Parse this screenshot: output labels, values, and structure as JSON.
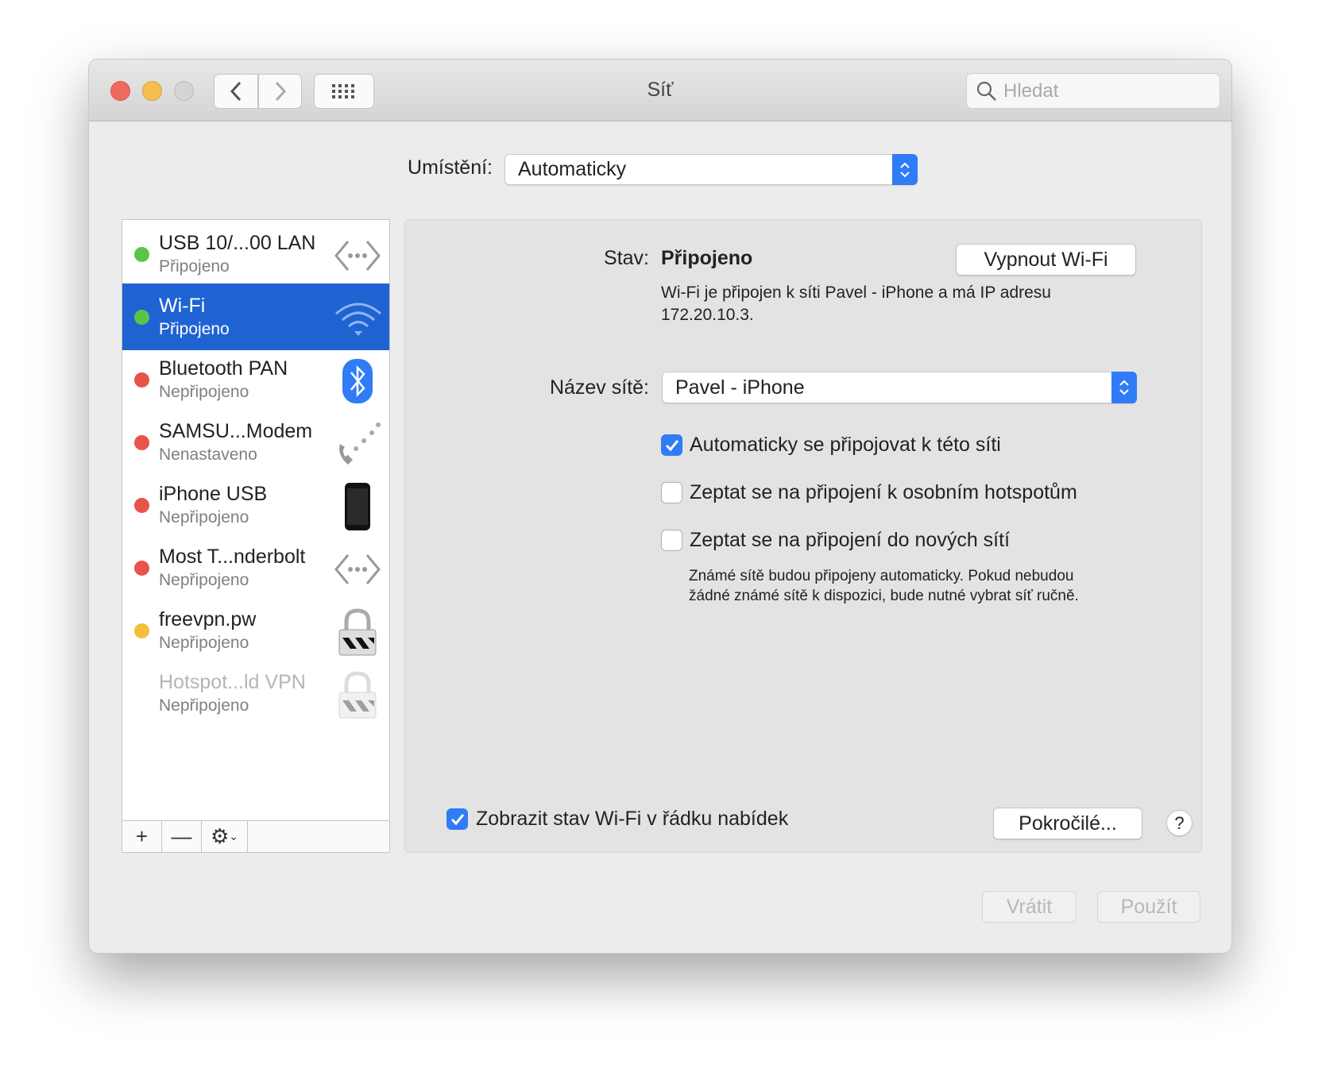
{
  "window": {
    "title": "Síť"
  },
  "search": {
    "placeholder": "Hledat"
  },
  "location": {
    "label": "Umístění:",
    "value": "Automaticky"
  },
  "services": [
    {
      "name": "USB 10/...00 LAN",
      "status": "Připojeno",
      "dot": "#5cc34a",
      "icon": "ethernet-icon"
    },
    {
      "name": "Wi-Fi",
      "status": "Připojeno",
      "dot": "#5cc34a",
      "icon": "wifi-icon",
      "selected": true
    },
    {
      "name": "Bluetooth PAN",
      "status": "Nepřipojeno",
      "dot": "#e8534a",
      "icon": "bluetooth-icon"
    },
    {
      "name": "SAMSU...Modem",
      "status": "Nenastaveno",
      "dot": "#e8534a",
      "icon": "phone-modem-icon"
    },
    {
      "name": "iPhone USB",
      "status": "Nepřipojeno",
      "dot": "#e8534a",
      "icon": "iphone-icon"
    },
    {
      "name": "Most T...nderbolt",
      "status": "Nepřipojeno",
      "dot": "#e8534a",
      "icon": "ethernet-icon"
    },
    {
      "name": "freevpn.pw",
      "status": "Nepřipojeno",
      "dot": "#f4bf3a",
      "icon": "vpn-lock-icon"
    },
    {
      "name": "Hotspot...ld VPN",
      "status": "Nepřipojeno",
      "icon": "vpn-lock-icon",
      "disabled": true
    }
  ],
  "toolbar": {
    "add": "+",
    "remove": "—",
    "gear": "⚙"
  },
  "detail": {
    "status_label": "Stav:",
    "status_value": "Připojeno",
    "toggle_wifi": "Vypnout Wi-Fi",
    "description_1": "Wi-Fi je připojen k síti Pavel - iPhone a má IP adresu",
    "description_2": "172.20.10.3.",
    "network_label": "Název sítě:",
    "network_value": "Pavel - iPhone",
    "options": [
      {
        "label": "Automaticky se připojovat k této síti",
        "checked": true
      },
      {
        "label": "Zeptat se na připojení k osobním hotspotům",
        "checked": false
      },
      {
        "label": "Zeptat se na připojení do nových sítí",
        "checked": false
      }
    ],
    "note_1": "Známé sítě budou připojeny automaticky. Pokud nebudou",
    "note_2": "žádné známé sítě k dispozici, bude nutné vybrat síť ručně.",
    "show_status": {
      "label": "Zobrazit stav Wi-Fi v řádku nabídek",
      "checked": true
    },
    "advanced": "Pokročilé...",
    "help": "?"
  },
  "footer": {
    "revert": "Vrátit",
    "apply": "Použít"
  },
  "colors": {
    "accent": "#2f7cf6",
    "selection": "#1f63d3"
  }
}
